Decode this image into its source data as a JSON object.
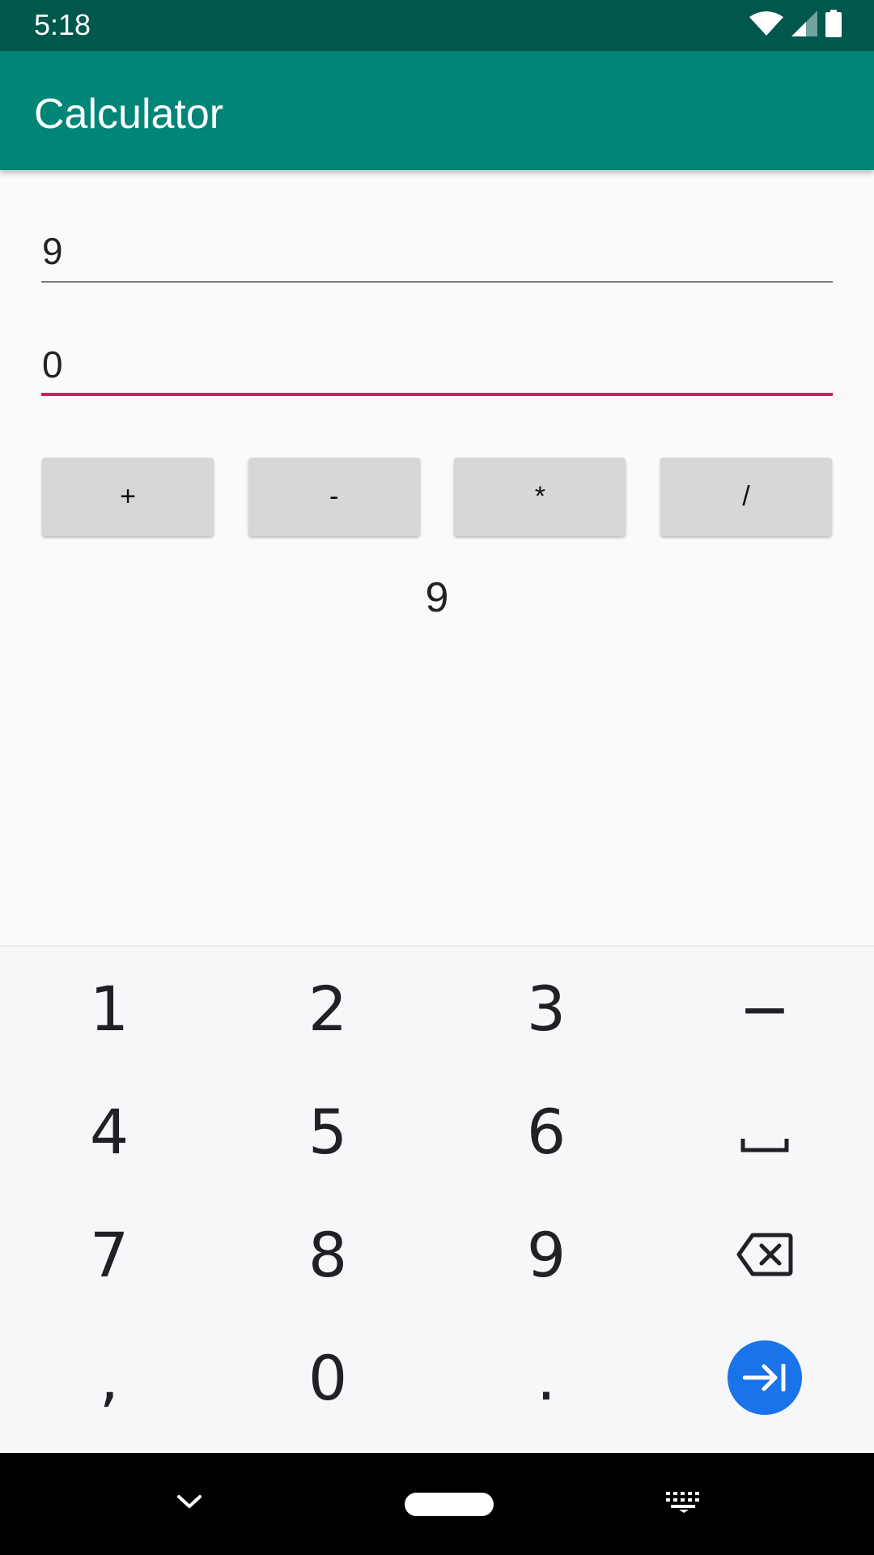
{
  "status_bar": {
    "time": "5:18",
    "icons": [
      "wifi-icon",
      "cell-signal-icon",
      "battery-icon"
    ]
  },
  "app_bar": {
    "title": "Calculator"
  },
  "form": {
    "first_number": "9",
    "second_number": "0"
  },
  "operations": {
    "add": "+",
    "subtract": "-",
    "multiply": "*",
    "divide": "/"
  },
  "result": "9",
  "keyboard": {
    "row1": [
      "1",
      "2",
      "3",
      "−"
    ],
    "row2": [
      "4",
      "5",
      "6"
    ],
    "row3": [
      "7",
      "8",
      "9"
    ],
    "row4": [
      ",",
      "0",
      "."
    ],
    "icons": [
      "space-icon",
      "backspace-icon",
      "next-field-icon"
    ]
  },
  "nav_bar": {
    "icons": [
      "back-chevron-icon",
      "home-pill-icon",
      "keyboard-switch-icon"
    ]
  },
  "colors": {
    "status_bar": "#00574b",
    "app_bar": "#008577",
    "accent": "#d81b60",
    "keyboard_action": "#1a73e8"
  }
}
